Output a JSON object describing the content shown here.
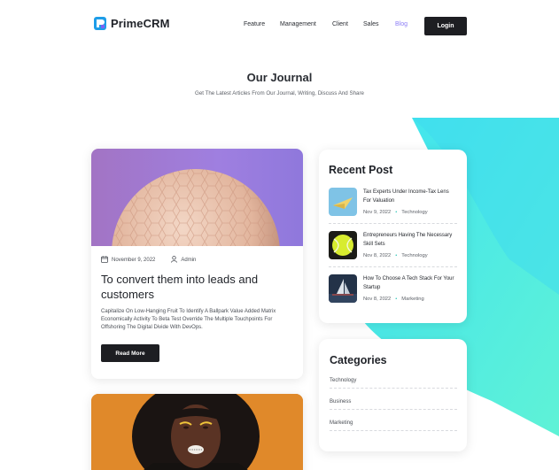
{
  "brand": {
    "name": "PrimeCRM",
    "accent": "#8b7cf6",
    "teal": "#2ec4b6"
  },
  "nav": {
    "items": [
      {
        "label": "Feature",
        "active": false
      },
      {
        "label": "Management",
        "active": false
      },
      {
        "label": "Client",
        "active": false
      },
      {
        "label": "Sales",
        "active": false
      },
      {
        "label": "Blog",
        "active": true
      }
    ],
    "login_label": "Login"
  },
  "journal": {
    "title": "Our Journal",
    "subtitle": "Get The Latest Articles From Our Journal, Writing, Discuss And Share"
  },
  "articles": [
    {
      "date": "November 9, 2022",
      "author": "Admin",
      "title": "To convert them into leads and customers",
      "excerpt": "Capitalize On Low-Hanging Fruit To Identify A Ballpark Value Added Matrix Economically Activity To Beta Test Override The Multiple Touchpoints For Offshoring The Digital Divide With DevOps.",
      "read_more": "Read More",
      "image": "sphere-image"
    },
    {
      "image": "portrait-image"
    }
  ],
  "recent": {
    "title": "Recent Post",
    "posts": [
      {
        "title": "Tax Experts Under Income-Tax Lens For Valuation",
        "date": "Nov 9, 2022",
        "category": "Technology",
        "thumb": "paper-plane-thumb"
      },
      {
        "title": "Entrepreneurs Having The Necessary Skill Sets",
        "date": "Nov 8, 2022",
        "category": "Technology",
        "thumb": "tennis-ball-thumb"
      },
      {
        "title": "How To Choose A Tech Stack For Your Startup",
        "date": "Nov 8, 2022",
        "category": "Marketing",
        "thumb": "sailboat-thumb"
      }
    ]
  },
  "categories": {
    "title": "Categories",
    "items": [
      "Technology",
      "Business",
      "Marketing"
    ]
  }
}
